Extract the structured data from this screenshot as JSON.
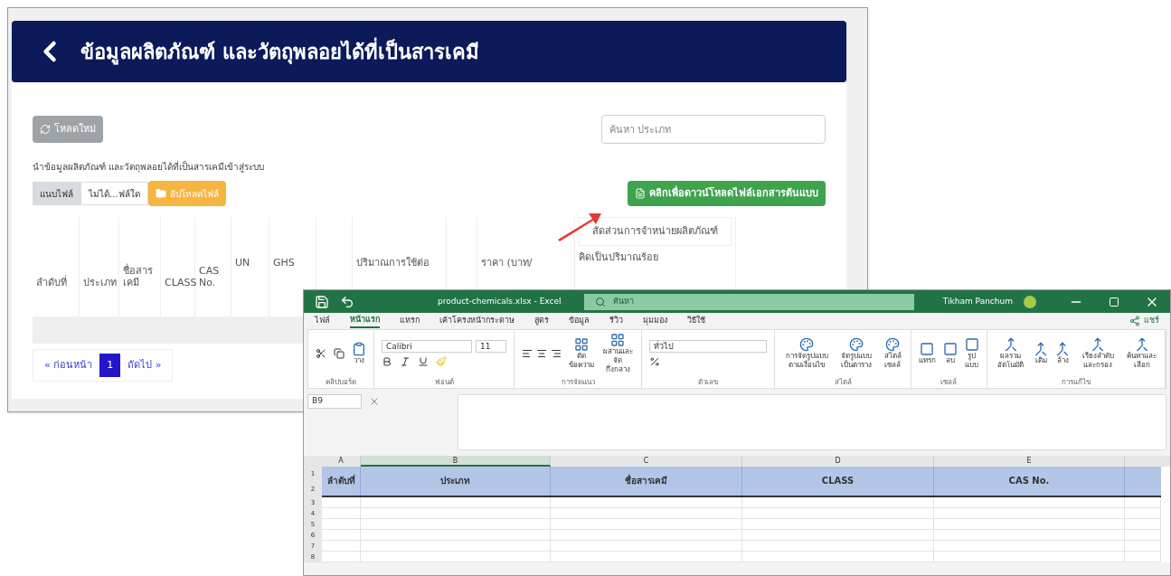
{
  "web_page": {
    "title": "ข้อมูลผลิตภัณฑ์ และวัตถุพลอยได้ที่เป็นสารเคมี",
    "reload_button": "โหลดใหม่",
    "search": {
      "placeholder": "ค้นหา ประเภท"
    },
    "import_label": "นำข้อมูลผลิตภัณฑ์ และวัตถุพลอยได้ที่เป็นสารเคมีเข้าสู่ระบบ",
    "file_input": {
      "button": "แนบไฟล์",
      "value": "ไม่ได้...ฟล์ใด"
    },
    "upload_button": "อัปโหลดไฟล์",
    "download_button": "คลิกเพื่อดาวน์โหลดไฟล์เอกสารต้นแบบ",
    "table": {
      "group_header": "สัดส่วนการจำหน่ายผลิตภัณฑ์",
      "columns": [
        "ลำดับที่",
        "ประเภท",
        "ชื่อสารเคมี",
        "CLASS",
        "CAS No.",
        "UN",
        "GHS",
        "",
        "ปริมาณการใช้ต่อ",
        "",
        "ราคา (บาท/",
        "คิดเป็นปริมาณร้อย"
      ]
    },
    "pagination": [
      {
        "label": "« ก่อนหน้า",
        "selected": false
      },
      {
        "label": "1",
        "selected": true
      },
      {
        "label": "ถัดไป »",
        "selected": false
      }
    ]
  },
  "excel": {
    "title": "product-chemicals.xlsx - Excel",
    "search": {
      "placeholder": "ค้นหา"
    },
    "user": "Tikham Panchum",
    "share": "แชร์",
    "ribbon_tabs": [
      {
        "label": "ไฟล์",
        "selected": false
      },
      {
        "label": "หน้าแรก",
        "selected": true
      },
      {
        "label": "แทรก",
        "selected": false
      },
      {
        "label": "เค้าโครงหน้ากระดาษ",
        "selected": false
      },
      {
        "label": "สูตร",
        "selected": false
      },
      {
        "label": "ข้อมูล",
        "selected": false
      },
      {
        "label": "รีวิว",
        "selected": false
      },
      {
        "label": "มุมมอง",
        "selected": false
      },
      {
        "label": "วิธีใช้",
        "selected": false
      }
    ],
    "font": {
      "name": "Calibri",
      "size": "11"
    },
    "number_format": "ทั่วไป",
    "ribbon_groups": [
      {
        "label": "คลิปบอร์ด",
        "buttons": [
          "วาง"
        ]
      },
      {
        "label": "ฟอนต์"
      },
      {
        "label": "การจัดแนว",
        "buttons": [
          "ตัดข้อความ",
          "ผสานและจัดกึ่งกลาง"
        ]
      },
      {
        "label": "ตัวเลข"
      },
      {
        "label": "สไตล์",
        "buttons": [
          "การจัดรูปแบบตามเงื่อนไข",
          "จัดรูปแบบเป็นตาราง",
          "สไตล์เซลล์"
        ]
      },
      {
        "label": "เซลล์",
        "buttons": [
          "แทรก",
          "ลบ",
          "รูปแบบ"
        ]
      },
      {
        "label": "การแก้ไข",
        "buttons": [
          "ผลรวมอัตโนมัติ",
          "เติม",
          "ล้าง",
          "เรียงลำดับและกรอง",
          "ค้นหาและเลือก"
        ]
      }
    ],
    "name_box": "B9",
    "columns": [
      "A",
      "B",
      "C",
      "D",
      "E"
    ],
    "rows": [
      "1",
      "2",
      "3",
      "4",
      "5",
      "6",
      "7",
      "8"
    ],
    "header_cells": [
      "ลำดับที่",
      "ประเภท",
      "ชื่อสารเคมี",
      "CLASS",
      "CAS No."
    ]
  }
}
